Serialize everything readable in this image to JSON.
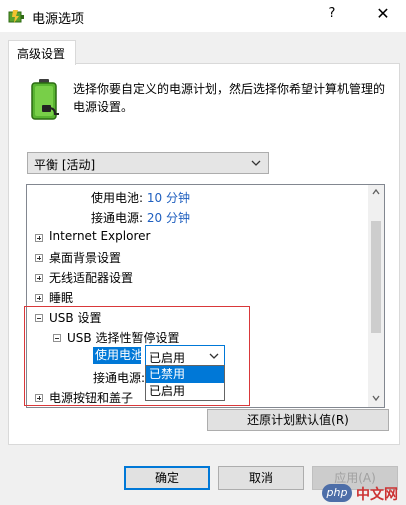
{
  "window": {
    "title": "电源选项",
    "help_label": "?",
    "close_label": "✕"
  },
  "tab": {
    "label": "高级设置"
  },
  "intro": {
    "text": "选择你要自定义的电源计划，然后选择你希望计算机管理的电源设置。"
  },
  "plan": {
    "selected": "平衡 [活动]"
  },
  "tree": {
    "items": [
      {
        "label": "使用电池:",
        "value": "10 分钟"
      },
      {
        "label": "接通电源:",
        "value": "20 分钟"
      },
      {
        "label": "Internet Explorer"
      },
      {
        "label": "桌面背景设置"
      },
      {
        "label": "无线适配器设置"
      },
      {
        "label": "睡眠"
      },
      {
        "label": "USB 设置"
      },
      {
        "label": "USB 选择性暂停设置"
      },
      {
        "label": "使用电池:"
      },
      {
        "label": "接通电源:"
      },
      {
        "label": "电源按钮和盖子"
      }
    ]
  },
  "combo": {
    "selected": "已启用",
    "options": [
      "已禁用",
      "已启用"
    ]
  },
  "buttons": {
    "restore": "还原计划默认值(R)",
    "ok": "确定",
    "cancel": "取消",
    "apply": "应用(A)"
  },
  "watermark": {
    "logo": "php",
    "text": "中文网"
  },
  "colors": {
    "accent": "#0078d7",
    "value_blue": "#1f5fbf",
    "highlight_box": "#d9383a"
  }
}
